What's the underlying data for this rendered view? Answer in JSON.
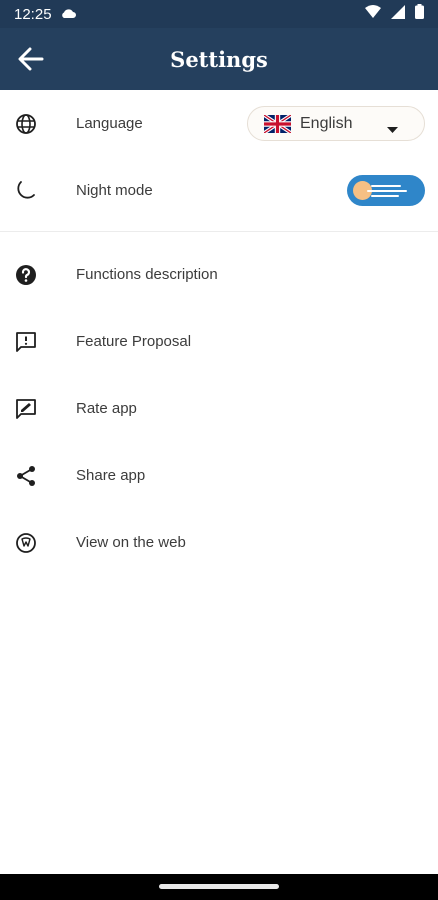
{
  "status_bar": {
    "time": "12:25"
  },
  "app_bar": {
    "title": "Settings"
  },
  "settings": {
    "language": {
      "label": "Language",
      "value": "English"
    },
    "night_mode": {
      "label": "Night mode",
      "enabled": true
    }
  },
  "menu": {
    "functions": "Functions description",
    "feature": "Feature Proposal",
    "rate": "Rate app",
    "share": "Share app",
    "web": "View on the web"
  },
  "colors": {
    "app_bar": "#25405e",
    "status_bar": "#213a57",
    "toggle_track": "#2f86c9",
    "toggle_knob": "#f6c084",
    "text": "#3c3c3c"
  }
}
